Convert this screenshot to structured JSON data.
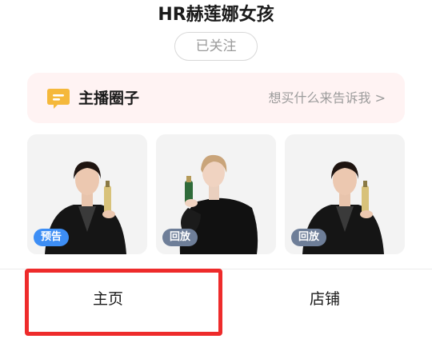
{
  "header": {
    "title": "HR赫莲娜女孩",
    "follow_label": "已关注"
  },
  "circle": {
    "icon": "chat-bubble-icon",
    "title": "主播圈子",
    "tip": "想买什么来告诉我 >",
    "background": "#fff3f3",
    "icon_color": "#f5b83b"
  },
  "videos": [
    {
      "tag": "预告",
      "tag_color": "#3d8ef5"
    },
    {
      "tag": "回放",
      "tag_color": "#6e7e98"
    },
    {
      "tag": "回放",
      "tag_color": "#6e7e98"
    }
  ],
  "tabs": {
    "home": "主页",
    "shop": "店铺"
  },
  "highlight_color": "#ee2b2b"
}
